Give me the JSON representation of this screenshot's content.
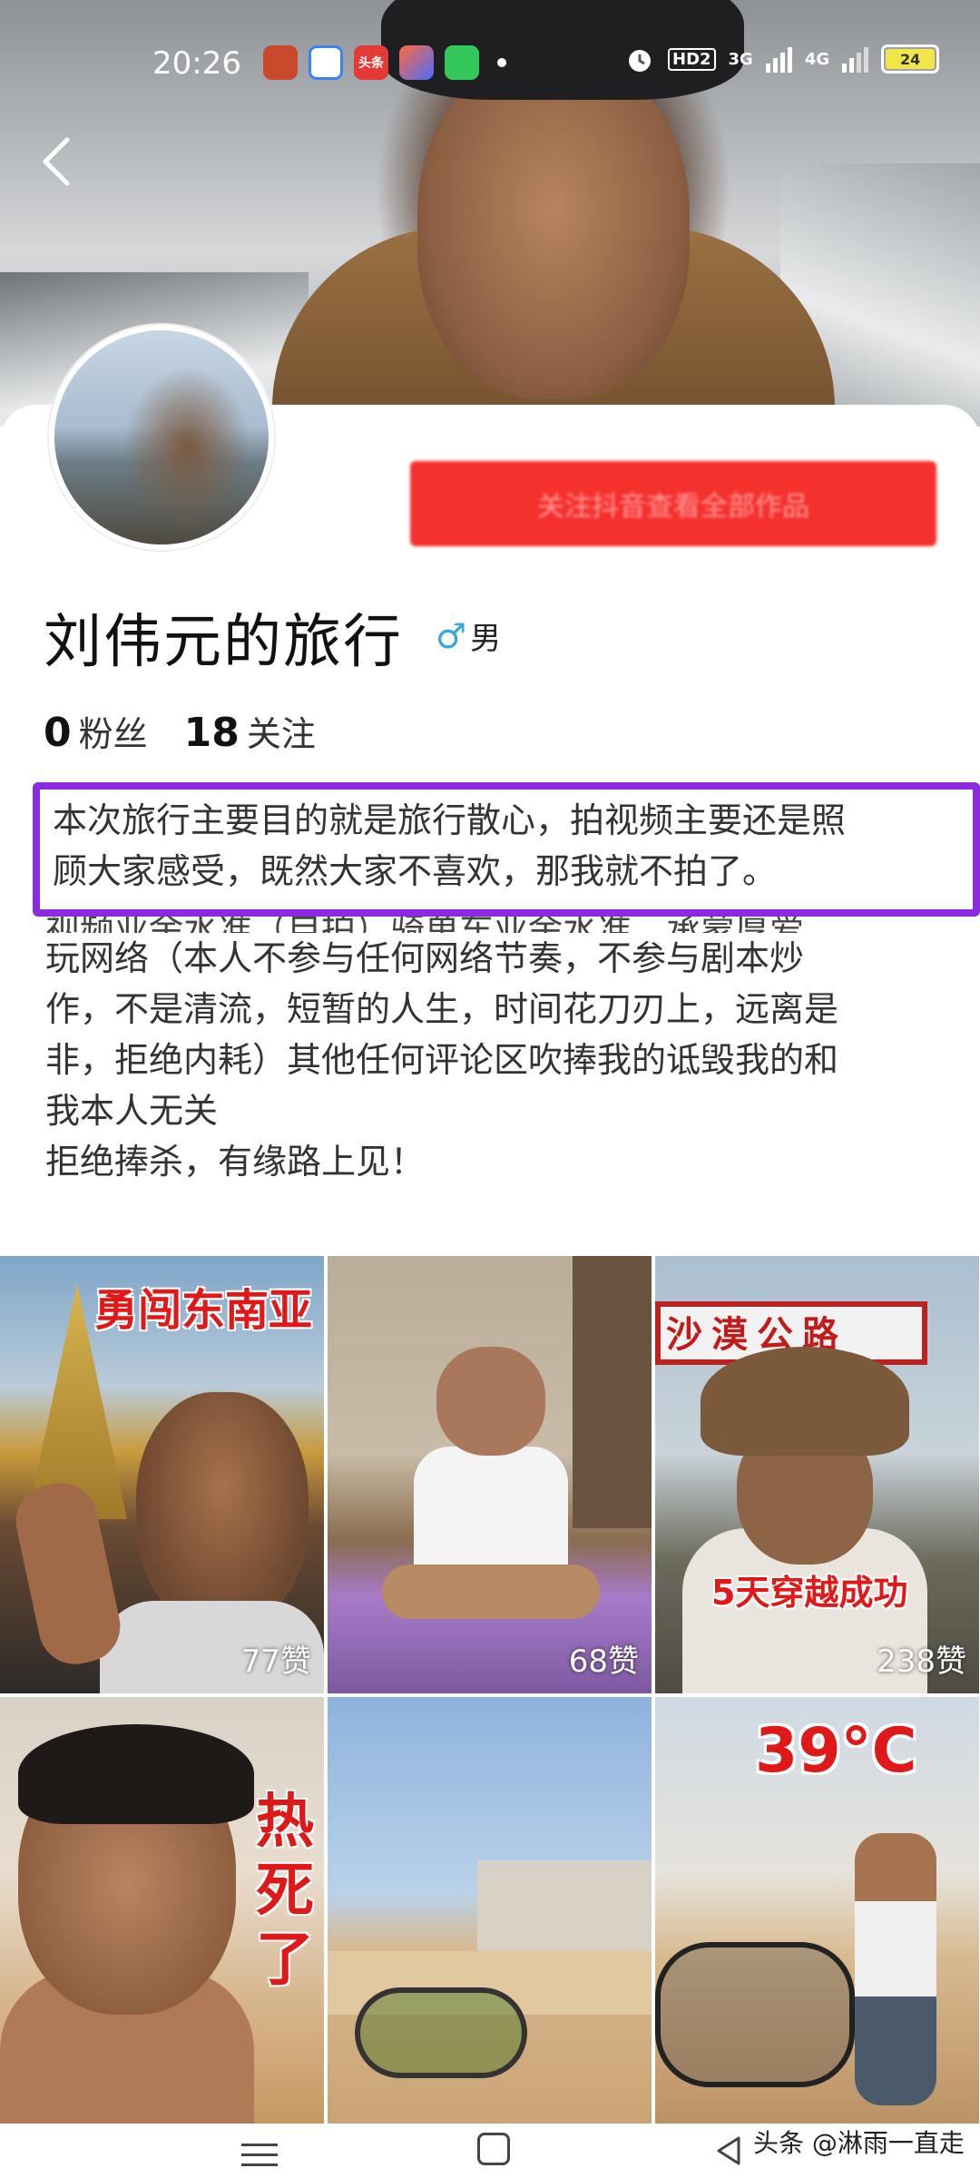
{
  "status_bar": {
    "time": "20:26",
    "app_icons": [
      "weather-app-icon",
      "photo-app-icon",
      "toutiao-app-icon",
      "shop-app-icon",
      "video-app-icon"
    ],
    "app_icon_labels": [
      "头条"
    ],
    "network_labels": [
      "HD2",
      "3G",
      "4G"
    ],
    "battery": "24"
  },
  "profile": {
    "name": "刘伟元的旅行",
    "gender_symbol": "♂",
    "gender": "男",
    "follow_button": "关注抖音查看全部作品",
    "fans_count": "0",
    "fans_label": "粉丝",
    "following_count": "18",
    "following_label": "关注"
  },
  "bio": {
    "highlighted": [
      "本次旅行主要目的就是旅行散心，拍视频主要还是照",
      "顾大家感受，既然大家不喜欢，那我就不拍了。"
    ],
    "partially_hidden": "视频业余水准（自拍）骑单车业余水准，承蒙厚爱",
    "lines": [
      "玩网络（本人不参与任何网络节奏，不参与剧本炒",
      "作，不是清流，短暂的人生，时间花刀刃上，远离是",
      "非，拒绝内耗）其他任何评论区吹捧我的诋毁我的和",
      "我本人无关",
      "拒绝捧杀，有缘路上见！"
    ]
  },
  "videos": [
    {
      "caption": "勇闯东南亚",
      "likes": "77赞"
    },
    {
      "caption": "",
      "likes": "68赞"
    },
    {
      "caption": "5天穿越成功",
      "sign": "沙漠公路",
      "likes": "238赞"
    },
    {
      "caption": "热死了",
      "likes": ""
    },
    {
      "caption": "",
      "likes": ""
    },
    {
      "caption": "39°C",
      "likes": ""
    }
  ],
  "watermark": "头条 @淋雨一直走",
  "colors": {
    "follow_button": "#f5312e",
    "highlight_border": "#8a2be2",
    "gender_symbol": "#3aa7e0",
    "caption_red": "#e01818"
  }
}
